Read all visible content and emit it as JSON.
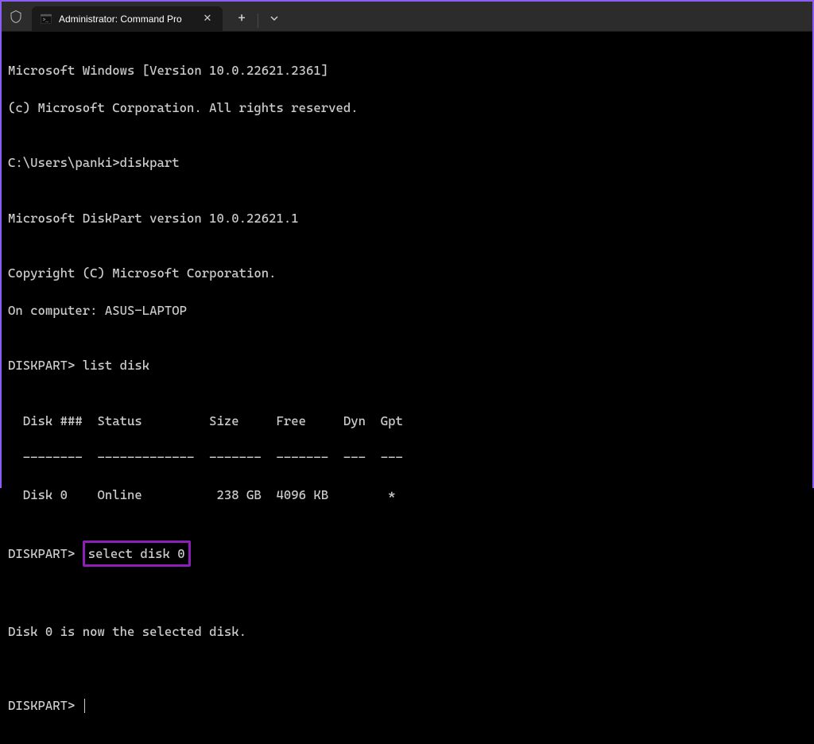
{
  "titlebar": {
    "tab_title": "Administrator: Command Pro"
  },
  "terminal": {
    "lines": [
      "Microsoft Windows [Version 10.0.22621.2361]",
      "(c) Microsoft Corporation. All rights reserved.",
      "",
      "C:\\Users\\panki>diskpart",
      "",
      "Microsoft DiskPart version 10.0.22621.1",
      "",
      "Copyright (C) Microsoft Corporation.",
      "On computer: ASUS-LAPTOP",
      "",
      "DISKPART> list disk",
      "",
      "  Disk ###  Status         Size     Free     Dyn  Gpt",
      "  --------  -------------  -------  -------  ---  ---",
      "  Disk 0    Online          238 GB  4096 KB        *",
      ""
    ],
    "highlighted_prompt": "DISKPART>",
    "highlighted_cmd": "select disk 0",
    "result_line": "Disk 0 is now the selected disk.",
    "final_prompt": "DISKPART> "
  }
}
